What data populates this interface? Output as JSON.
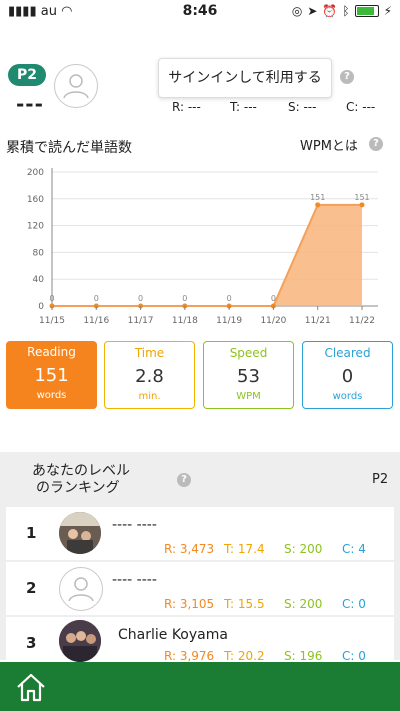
{
  "status_bar": {
    "carrier": "au",
    "time": "8:46"
  },
  "header": {
    "level": "P2",
    "level_name": "---",
    "signin_label": "サインインして利用する",
    "help_glyph": "?",
    "stats": {
      "r": "R: ---",
      "t": "T: ---",
      "s": "S: ---",
      "c": "C: ---"
    }
  },
  "chart_section": {
    "title": "累積で読んだ単語数",
    "wpm_link": "WPMとは"
  },
  "chart_data": {
    "type": "area",
    "categories": [
      "11/15",
      "11/16",
      "11/17",
      "11/18",
      "11/19",
      "11/20",
      "11/21",
      "11/22"
    ],
    "values": [
      0,
      0,
      0,
      0,
      0,
      0,
      151,
      151
    ],
    "data_labels": [
      "0",
      "0",
      "0",
      "0",
      "0",
      "0",
      "151",
      "151"
    ],
    "yticks": [
      "0",
      "20",
      "40",
      "60",
      "80",
      "100",
      "120",
      "140",
      "160",
      "180",
      "200"
    ],
    "ylim": [
      0,
      200
    ],
    "grid": true
  },
  "tiles": [
    {
      "label": "Reading",
      "value": "151",
      "unit": "words"
    },
    {
      "label": "Time",
      "value": "2.8",
      "unit": "min."
    },
    {
      "label": "Speed",
      "value": "53",
      "unit": "WPM"
    },
    {
      "label": "Cleared",
      "value": "0",
      "unit": "words"
    }
  ],
  "ranking": {
    "title_line1": "あなたのレベル",
    "title_line2": "のランキング",
    "level": "P2",
    "rows": [
      {
        "rank": "1",
        "name": "---- ----",
        "r": "R: 3,473",
        "t": "T: 17.4",
        "s": "S: 200",
        "c": "C: 4"
      },
      {
        "rank": "2",
        "name": "---- ----",
        "r": "R: 3,105",
        "t": "T: 15.5",
        "s": "S: 200",
        "c": "C: 0"
      },
      {
        "rank": "3",
        "name": "Charlie Koyama",
        "r": "R: 3,976",
        "t": "T: 20.2",
        "s": "S: 196",
        "c": "C: 0"
      }
    ]
  },
  "colors": {
    "r": "#f08a24",
    "t": "#f0a500",
    "s": "#8dc21f",
    "c": "#2aa2d4",
    "tabbar": "#1a7d33",
    "badge": "#1f8a70"
  }
}
